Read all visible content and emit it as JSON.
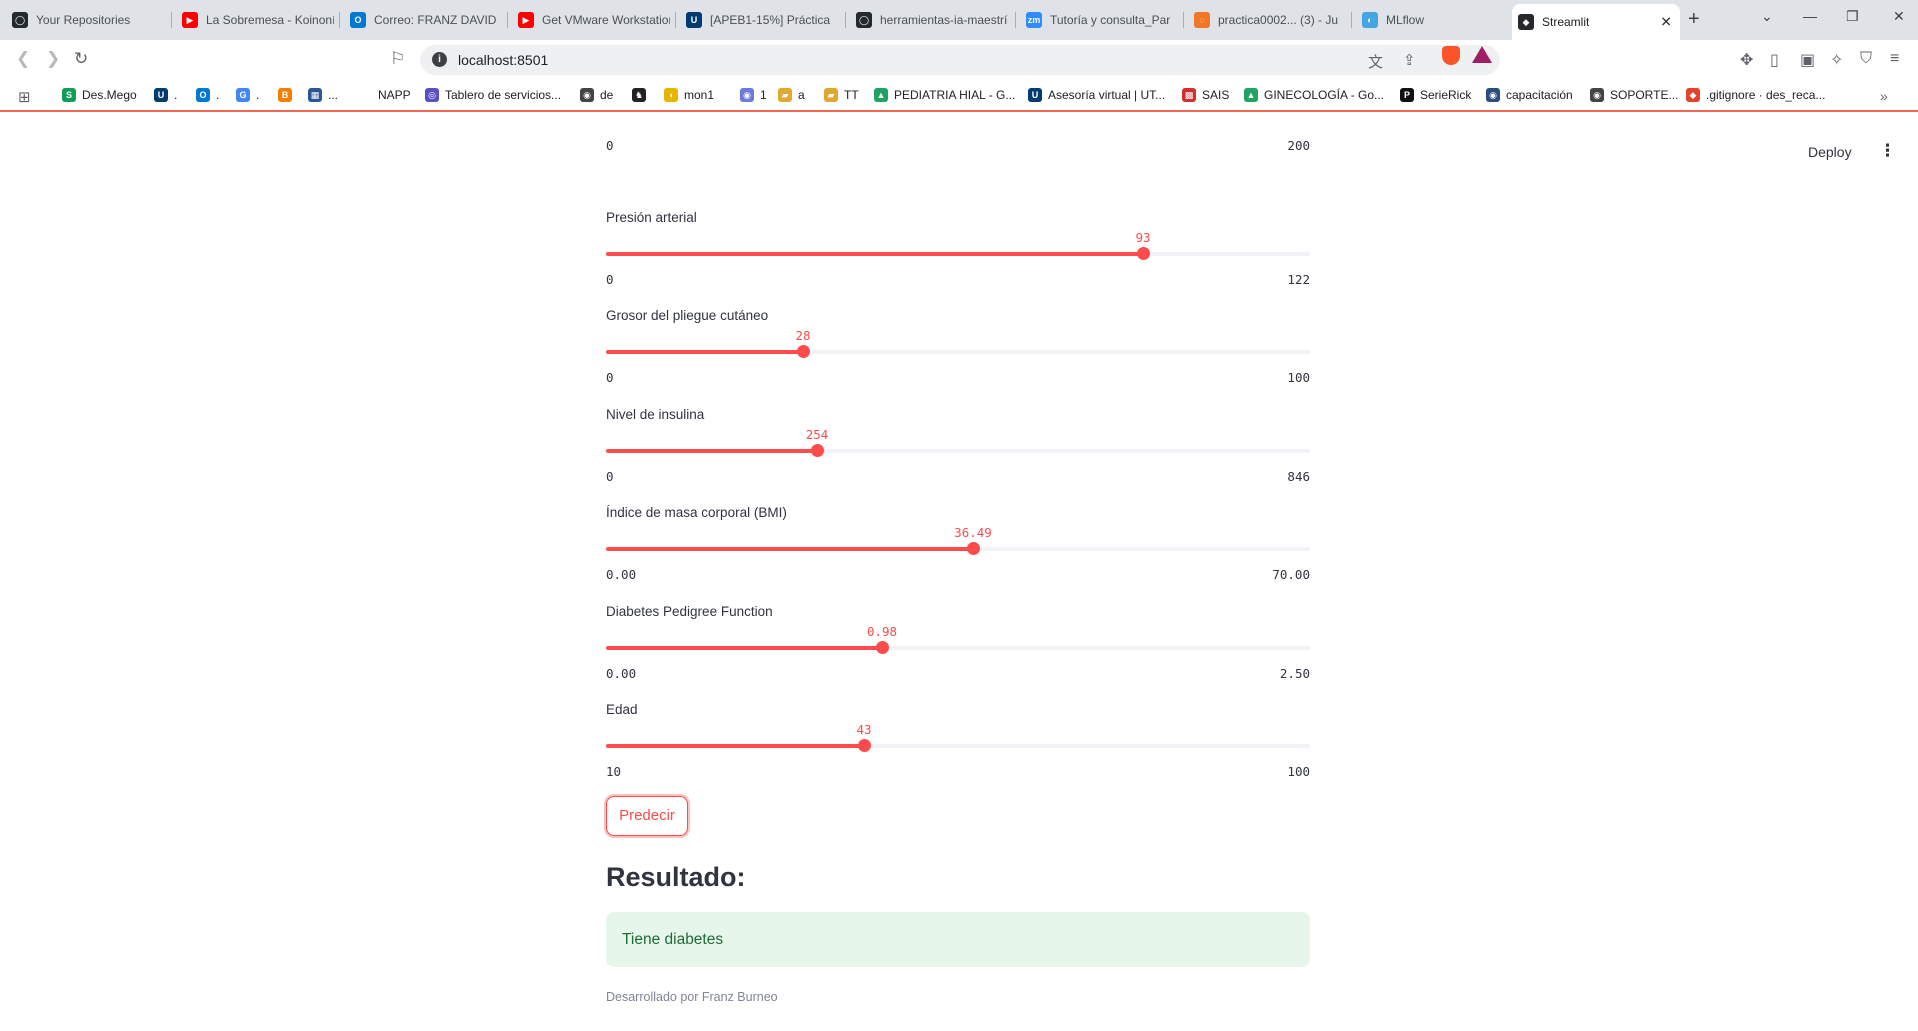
{
  "browser": {
    "tabs": [
      {
        "title": "Your Repositories",
        "color": "#24292f",
        "glyph": "◯"
      },
      {
        "title": "La Sobremesa - Koinonía",
        "color": "#ff0000",
        "glyph": "▶"
      },
      {
        "title": "Correo: FRANZ DAVID",
        "color": "#0078d4",
        "glyph": "O"
      },
      {
        "title": "Get VMware Workstation",
        "color": "#ff0000",
        "glyph": "▶"
      },
      {
        "title": "[APEB1-15%] Práctica",
        "color": "#003c71",
        "glyph": "U"
      },
      {
        "title": "herramientas-ia-maestría",
        "color": "#24292f",
        "glyph": "◯"
      },
      {
        "title": "Tutoría y consulta_Par",
        "color": "#2d8cff",
        "glyph": "zm"
      },
      {
        "title": "practica0002... (3) - Ju",
        "color": "#f37626",
        "glyph": "◌"
      },
      {
        "title": "MLflow",
        "color": "#43a6e3",
        "glyph": "◐"
      }
    ],
    "active_tab": {
      "title": "Streamlit",
      "color": "#262730",
      "glyph": "◆"
    },
    "url": "localhost:8501",
    "bookmarks": [
      {
        "label": "Des.Mego",
        "color": "#0f9d58",
        "glyph": "S"
      },
      {
        "label": ".",
        "color": "#003c71",
        "glyph": "U"
      },
      {
        "label": ".",
        "color": "#0078d4",
        "glyph": "O"
      },
      {
        "label": ".",
        "color": "#4285f4",
        "glyph": "G"
      },
      {
        "label": "",
        "color": "#f57d00",
        "glyph": "B"
      },
      {
        "label": "...",
        "color": "#2b5797",
        "glyph": "▦"
      },
      {
        "label": "NAPP",
        "color": "#ffffff",
        "glyph": ""
      },
      {
        "label": "Tablero de servicios...",
        "color": "#5b4fc4",
        "glyph": "◎"
      },
      {
        "label": "de",
        "color": "#444444",
        "glyph": "◉"
      },
      {
        "label": "",
        "color": "#222222",
        "glyph": "♞"
      },
      {
        "label": "mon1",
        "color": "#e8b400",
        "glyph": "◖"
      },
      {
        "label": "1",
        "color": "#6c7ae0",
        "glyph": "◉"
      },
      {
        "label": "a",
        "color": "#e0a82e",
        "glyph": "▰"
      },
      {
        "label": "TT",
        "color": "#e0a82e",
        "glyph": "▰"
      },
      {
        "label": "PEDIATRIA HIAL - G...",
        "color": "#1fa463",
        "glyph": "▲"
      },
      {
        "label": "Asesoría virtual | UT...",
        "color": "#003c71",
        "glyph": "U"
      },
      {
        "label": "SAIS",
        "color": "#d32f2f",
        "glyph": "▩"
      },
      {
        "label": "GINECOLOGÍA - Go...",
        "color": "#1fa463",
        "glyph": "▲"
      },
      {
        "label": "SerieRick",
        "color": "#111111",
        "glyph": "P"
      },
      {
        "label": "capacitación",
        "color": "#2b4c7e",
        "glyph": "◉"
      },
      {
        "label": "SOPORTE...",
        "color": "#444444",
        "glyph": "◉"
      },
      {
        "label": ".gitignore · des_reca...",
        "color": "#e24329",
        "glyph": "◆"
      }
    ]
  },
  "app": {
    "deploy_label": "Deploy",
    "kebab": "⋮",
    "top_slider": {
      "min": "0",
      "max": "200"
    },
    "sliders": [
      {
        "label": "Presión arterial",
        "value": 93,
        "display": "93",
        "min": 0,
        "max": 122,
        "min_label": "0",
        "max_label": "122"
      },
      {
        "label": "Grosor del pliegue cutáneo",
        "value": 28,
        "display": "28",
        "min": 0,
        "max": 100,
        "min_label": "0",
        "max_label": "100"
      },
      {
        "label": "Nivel de insulina",
        "value": 254,
        "display": "254",
        "min": 0,
        "max": 846,
        "min_label": "0",
        "max_label": "846"
      },
      {
        "label": "Índice de masa corporal (BMI)",
        "value": 36.49,
        "display": "36.49",
        "min": 0,
        "max": 70,
        "min_label": "0.00",
        "max_label": "70.00"
      },
      {
        "label": "Diabetes Pedigree Function",
        "value": 0.98,
        "display": "0.98",
        "min": 0,
        "max": 2.5,
        "min_label": "0.00",
        "max_label": "2.50"
      },
      {
        "label": "Edad",
        "value": 43,
        "display": "43",
        "min": 10,
        "max": 100,
        "min_label": "10",
        "max_label": "100"
      }
    ],
    "predict_label": "Predecir",
    "result_heading": "Resultado:",
    "result_text": "Tiene diabetes",
    "footer": "Desarrollado por Franz Burneo",
    "accent_color": "#ff4b4b",
    "success_bg": "#e6f6ea"
  }
}
